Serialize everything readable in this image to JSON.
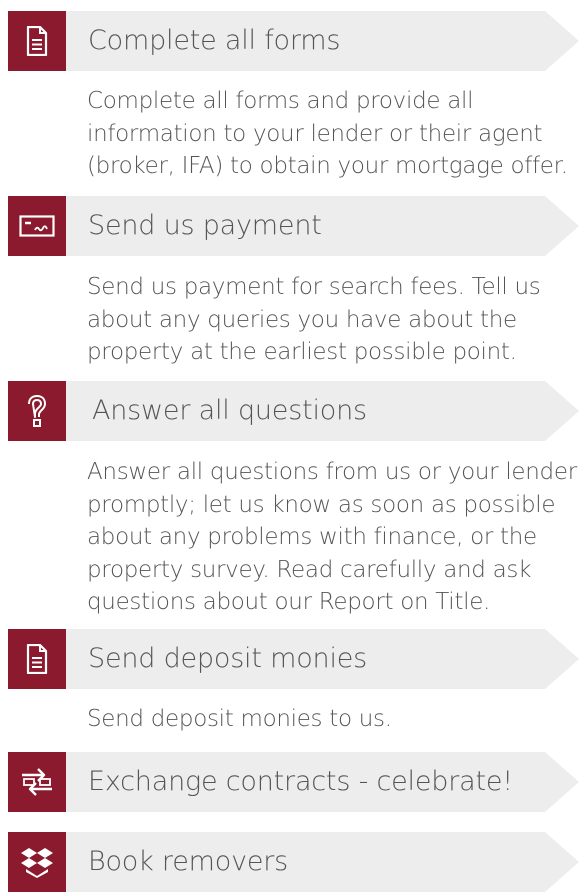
{
  "theme": {
    "accent": "#8b1a2e",
    "banner": "#ededed",
    "text": "#555555"
  },
  "steps": [
    {
      "icon": "document-icon",
      "title": "Complete all forms",
      "description": "Complete all forms and provide all information to your lender or their agent (broker, IFA) to obtain your mortgage offer."
    },
    {
      "icon": "cheque-icon",
      "title": "Send us payment",
      "description": "Send us payment for search fees. Tell us about any queries you have about the property at the earliest possible point."
    },
    {
      "icon": "question-mark-icon",
      "title": "Answer all questions",
      "description": "Answer all questions from us or your lender promptly; let us know as soon as possible about any problems with finance, or the property survey. Read carefully and ask questions about our Report on Title."
    },
    {
      "icon": "document-icon",
      "title": "Send deposit monies",
      "description": "Send deposit monies to us."
    },
    {
      "icon": "exchange-icon",
      "title": "Exchange contracts - celebrate!",
      "description": ""
    },
    {
      "icon": "boxes-icon",
      "title": "Book removers",
      "description": ""
    }
  ]
}
